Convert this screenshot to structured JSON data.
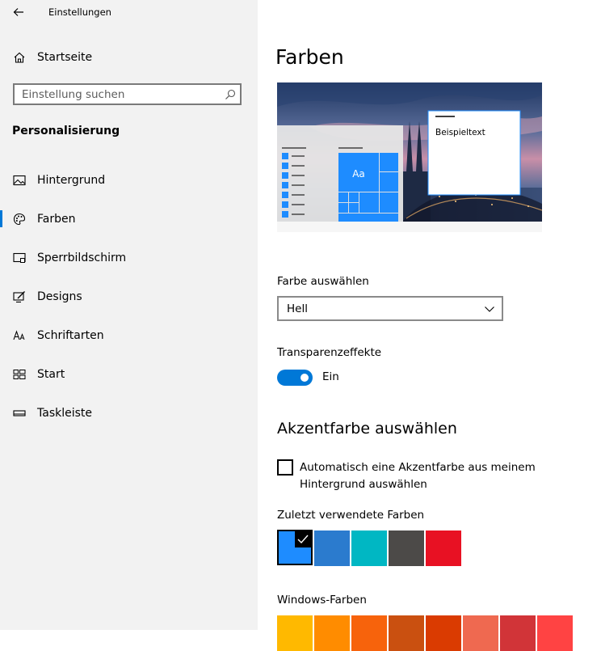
{
  "window": {
    "title": "Einstellungen"
  },
  "sidebar": {
    "home_label": "Startseite",
    "search_placeholder": "Einstellung suchen",
    "section_title": "Personalisierung",
    "items": [
      {
        "label": "Hintergrund",
        "icon": "picture-icon"
      },
      {
        "label": "Farben",
        "icon": "palette-icon",
        "active": true
      },
      {
        "label": "Sperrbildschirm",
        "icon": "lock-screen-icon"
      },
      {
        "label": "Designs",
        "icon": "brush-icon"
      },
      {
        "label": "Schriftarten",
        "icon": "font-icon"
      },
      {
        "label": "Start",
        "icon": "start-menu-icon"
      },
      {
        "label": "Taskleiste",
        "icon": "taskbar-icon"
      }
    ]
  },
  "main": {
    "title": "Farben",
    "preview": {
      "sample_text": "Beispieltext",
      "tile_text": "Aa"
    },
    "color_mode": {
      "label": "Farbe auswählen",
      "value": "Hell"
    },
    "transparency": {
      "label": "Transparenzeffekte",
      "state": "Ein"
    },
    "accent": {
      "heading": "Akzentfarbe auswählen",
      "auto_label": "Automatisch eine Akzentfarbe aus meinem Hintergrund auswählen",
      "recent_label": "Zuletzt verwendete Farben",
      "recent_colors": [
        "#1e8cff",
        "#2b7bce",
        "#00b7c3",
        "#4c4a48",
        "#e81123"
      ],
      "windows_label": "Windows-Farben",
      "windows_colors": [
        "#ffb900",
        "#ff8c00",
        "#f7630c",
        "#ca5010",
        "#da3b01",
        "#ef6950",
        "#d13438",
        "#ff4343"
      ]
    }
  },
  "colors": {
    "accent": "#0078d7",
    "sidebar_bg": "#f2f2f2"
  }
}
